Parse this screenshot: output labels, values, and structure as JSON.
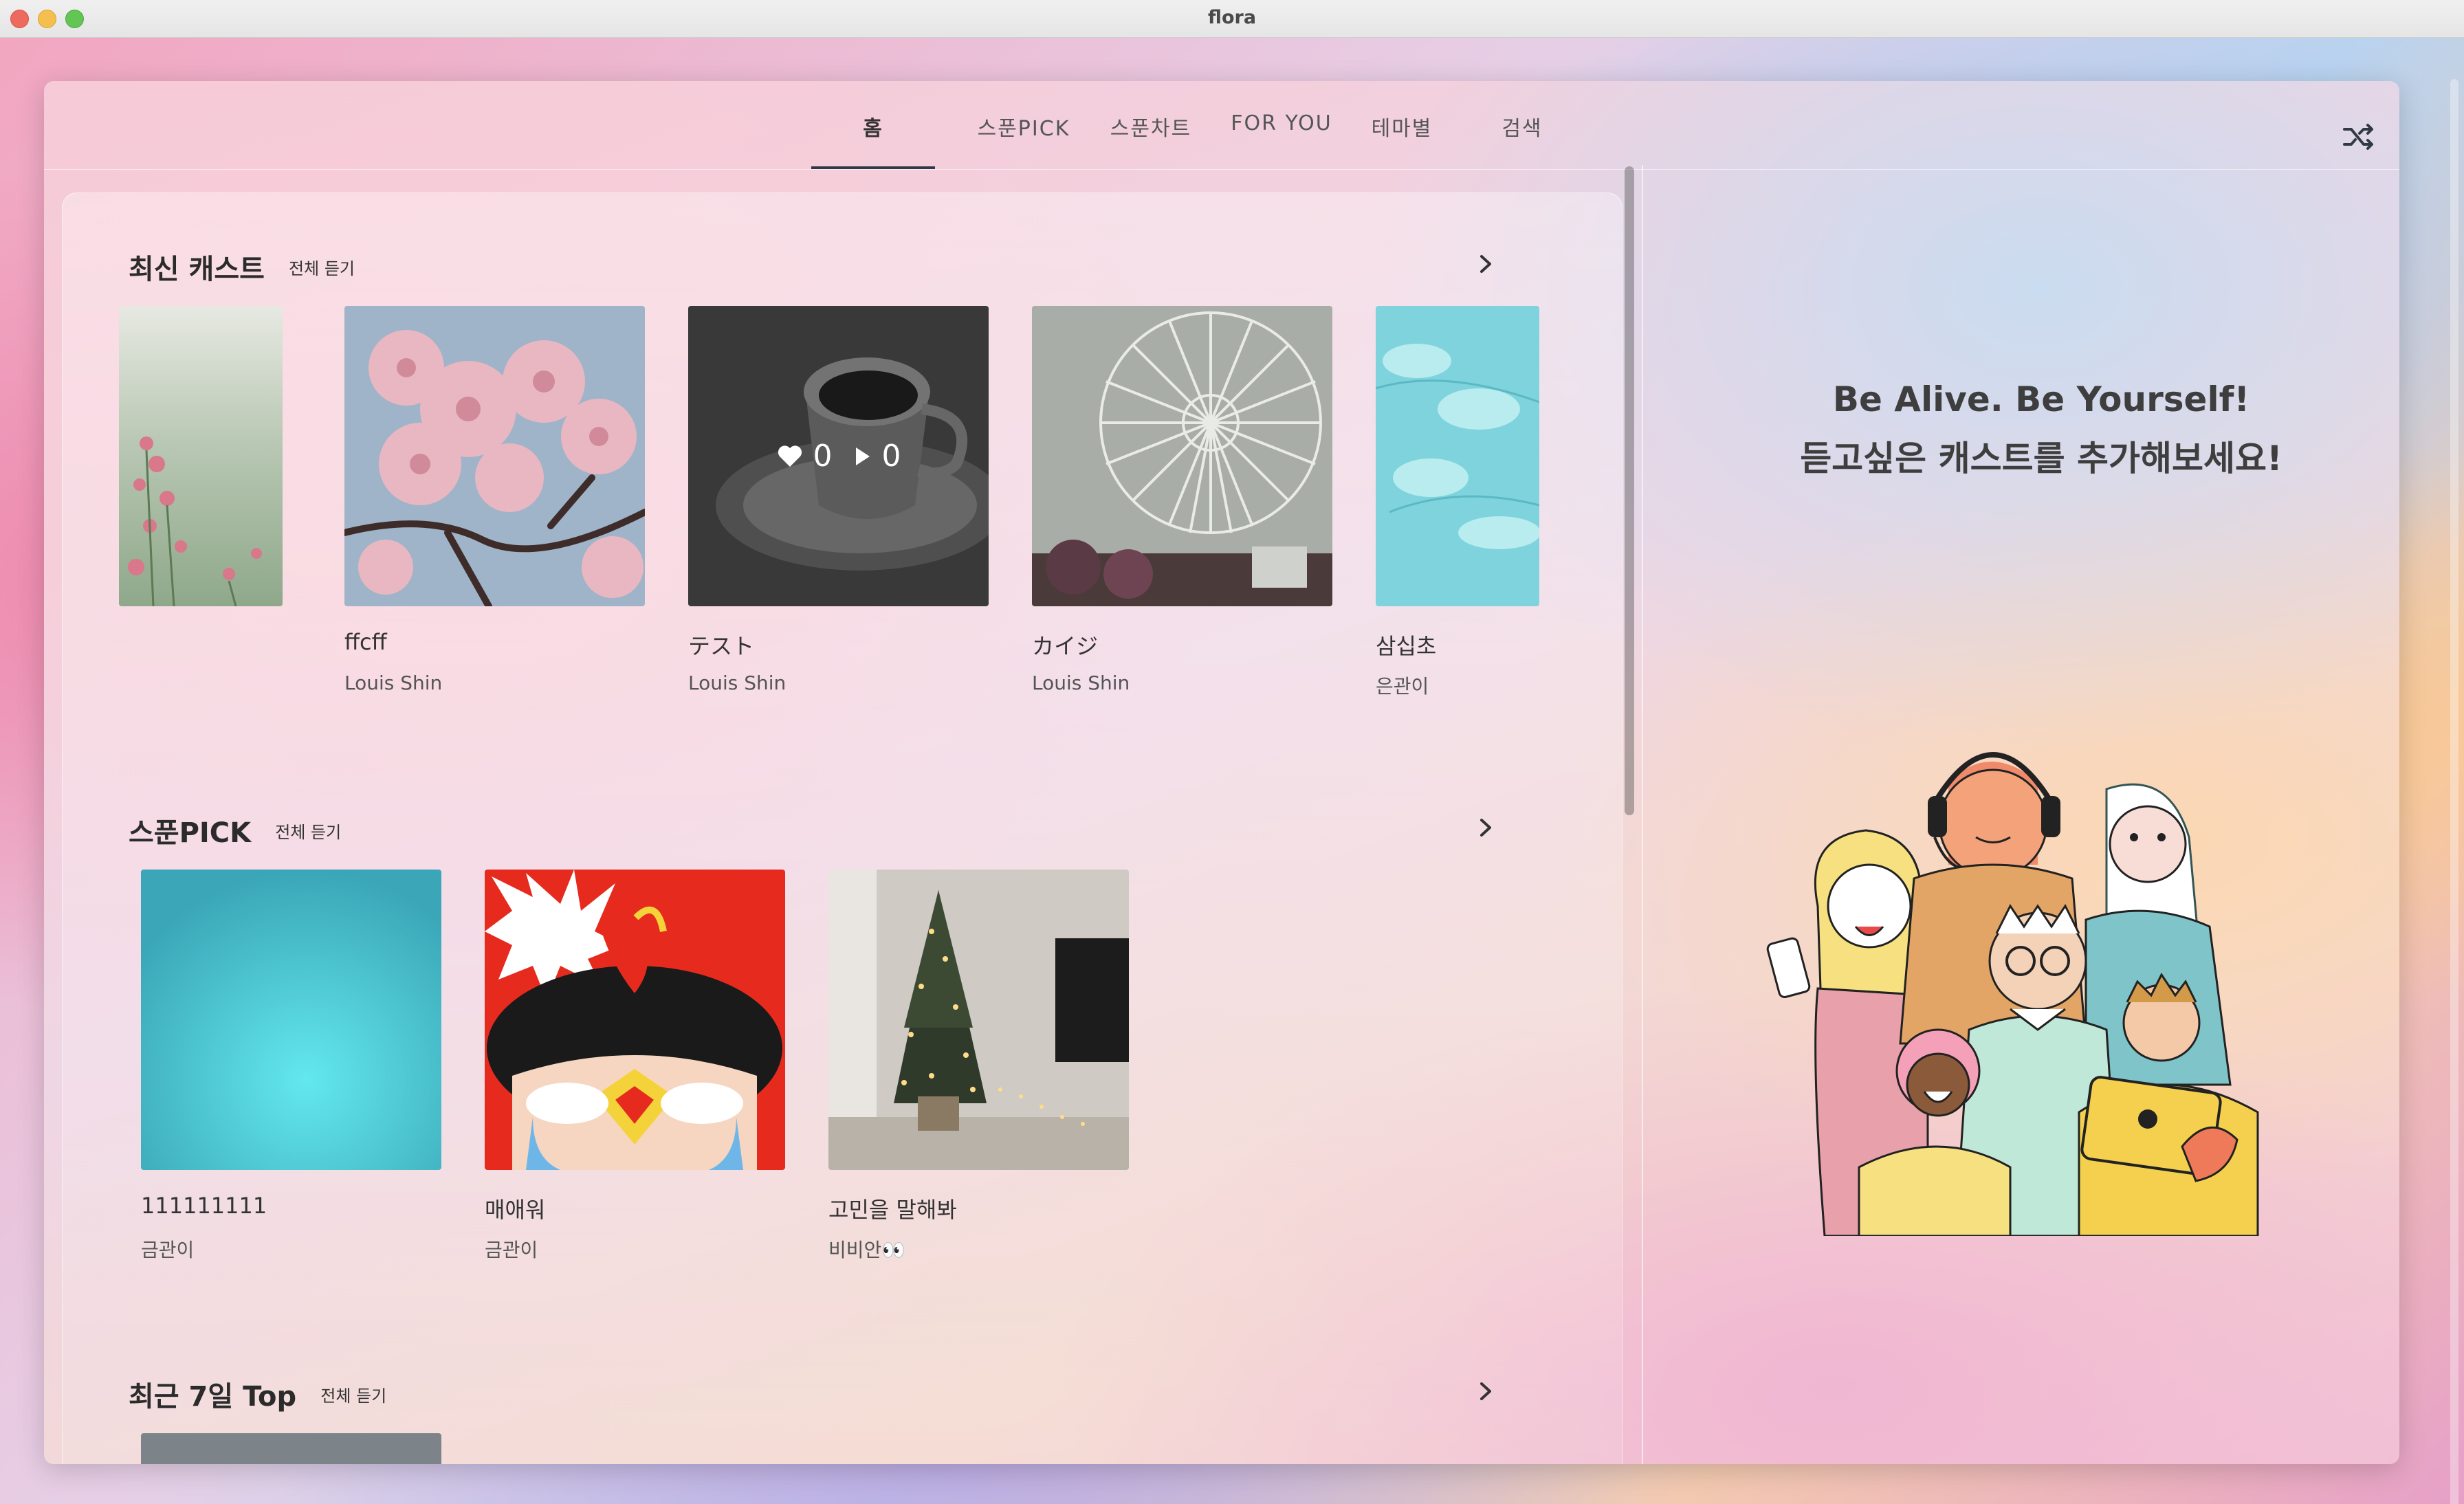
{
  "window": {
    "title": "flora"
  },
  "nav": {
    "tabs": [
      {
        "label": "홈",
        "active": true
      },
      {
        "label": "스푼PICK",
        "active": false
      },
      {
        "label": "스푼차트",
        "active": false
      },
      {
        "label": "FOR YOU",
        "active": false
      },
      {
        "label": "테마별",
        "active": false
      },
      {
        "label": "검색",
        "active": false
      }
    ],
    "shuffle_icon": "shuffle-icon"
  },
  "sections": [
    {
      "title": "최신 캐스트",
      "see_all": "전체 듣기",
      "cards": [
        {
          "title": "",
          "author": "",
          "image": "pink-wildflowers"
        },
        {
          "title": "ffcff",
          "author": "Louis Shin",
          "image": "cherry-blossoms"
        },
        {
          "title": "テスト",
          "author": "Louis Shin",
          "image": "coffee-cup-bw",
          "likes": "0",
          "plays": "0"
        },
        {
          "title": "カイジ",
          "author": "Louis Shin",
          "image": "ferris-wheel"
        },
        {
          "title": "삼십초",
          "author": "은관이",
          "image": "cyan-leaves"
        }
      ]
    },
    {
      "title": "스푼PICK",
      "see_all": "전체 듣기",
      "cards": [
        {
          "title": "111111111",
          "author": "금관이",
          "image": "teal-gradient"
        },
        {
          "title": "매애워",
          "author": "금관이",
          "image": "cartoon-face"
        },
        {
          "title": "고민을 말해봐",
          "author": "비비안👀",
          "image": "christmas-tree"
        }
      ]
    },
    {
      "title": "최근 7일 Top",
      "see_all": "전체 듣기",
      "cards": []
    }
  ],
  "promo": {
    "line1": "Be Alive. Be Yourself!",
    "line2": "듣고싶은 캐스트를 추가해보세요!"
  },
  "colors": {
    "accent": "#2f3a44",
    "text": "#333333"
  }
}
